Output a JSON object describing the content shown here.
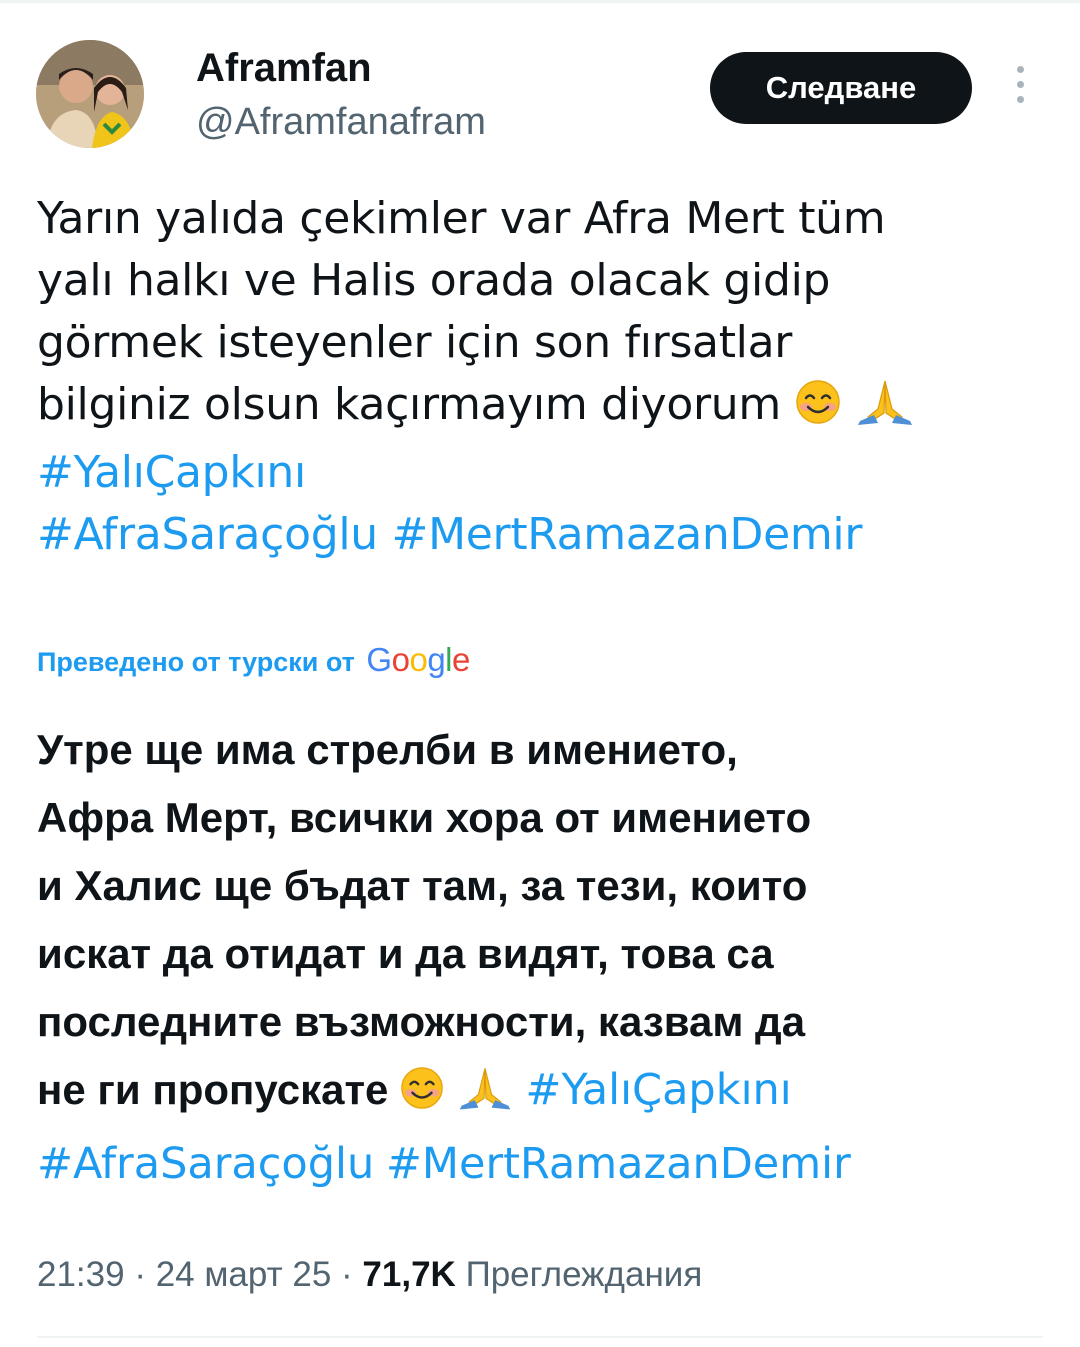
{
  "author": {
    "name": "Aframfan",
    "handle": "@Aframfanafram"
  },
  "follow_button": {
    "label": "Следване"
  },
  "more_icon": "more-vertical-icon",
  "tweet": {
    "text_lines": [
      "Yarın yalıda çekimler var Afra Mert tüm",
      "yalı halkı ve Halis orada olacak gidip",
      "görmek isteyenler için son fırsatlar",
      "bilginiz olsun kaçırmayım diyorum"
    ],
    "hashtags": [
      "#YalıÇapkını",
      "#AfraSaraçoğlu",
      "#MertRamazanDemir"
    ],
    "emojis": [
      "smiling-face-emoji",
      "folded-hands-emoji"
    ]
  },
  "translation": {
    "label": "Преведено от турски от",
    "provider": "Google",
    "text_lines": [
      "Утре ще има стрелби в имението,",
      "Афра Мерт, всички хора от имението",
      "и Халис ще бъдат там, за тези, които",
      "искат да отидат и да видят, това са",
      "последните възможности, казвам да",
      "не ги пропускате"
    ],
    "hashtags": [
      "#YalıÇapkını",
      "#AfraSaraçoğlu",
      "#MertRamazanDemir"
    ]
  },
  "meta": {
    "time": "21:39",
    "date": "24 март 25",
    "separator": "·",
    "views_count": "71,7K",
    "views_label": "Преглеждания"
  },
  "colors": {
    "link": "#1d9bf0",
    "text": "#0f1419",
    "secondary": "#536471",
    "button_bg": "#0f1419",
    "google_blue": "#4285F4",
    "google_red": "#EA4335",
    "google_yellow": "#FBBC05",
    "google_green": "#34A853"
  }
}
